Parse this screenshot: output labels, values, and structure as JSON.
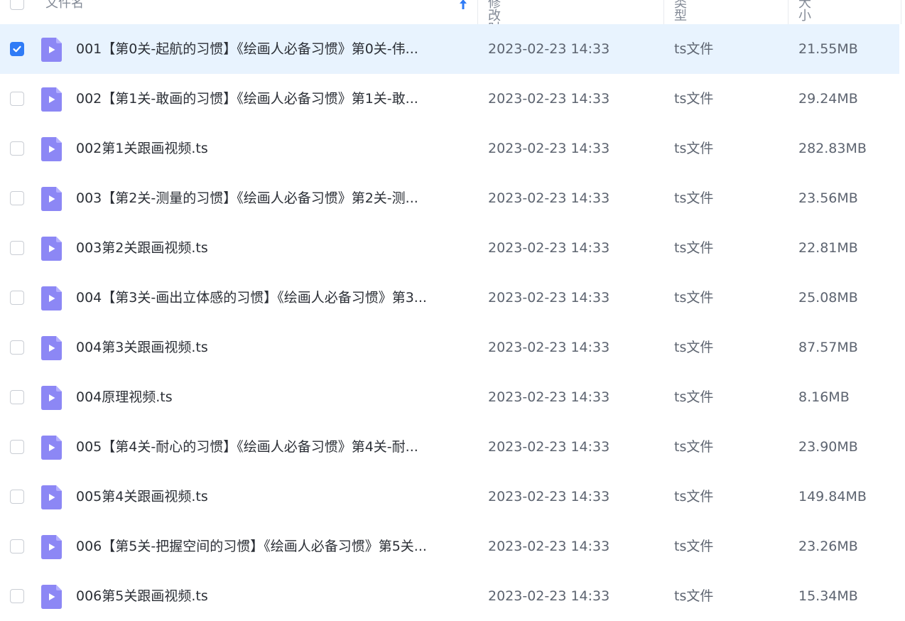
{
  "header": {
    "col_name": "文件名",
    "col_mtime": "修改时间",
    "col_type": "类型",
    "col_size": "大小",
    "sort_icon": "arrow-up-icon",
    "accent": "#2f7bf6"
  },
  "colors": {
    "selected_row_bg": "#e8f3fe",
    "checkbox_checked": "#2f7bf6",
    "file_icon": "#8c87f5"
  },
  "files": [
    {
      "name": "001【第0关-起航的习惯】《绘画人必备习惯》第0关-伟...",
      "mtime": "2023-02-23 14:33",
      "type": "ts文件",
      "size": "21.55MB",
      "checked": true
    },
    {
      "name": "002【第1关-敢画的习惯】《绘画人必备习惯》第1关-敢...",
      "mtime": "2023-02-23 14:33",
      "type": "ts文件",
      "size": "29.24MB",
      "checked": false
    },
    {
      "name": "002第1关跟画视频.ts",
      "mtime": "2023-02-23 14:33",
      "type": "ts文件",
      "size": "282.83MB",
      "checked": false
    },
    {
      "name": "003【第2关-测量的习惯】《绘画人必备习惯》第2关-测...",
      "mtime": "2023-02-23 14:33",
      "type": "ts文件",
      "size": "23.56MB",
      "checked": false
    },
    {
      "name": "003第2关跟画视频.ts",
      "mtime": "2023-02-23 14:33",
      "type": "ts文件",
      "size": "22.81MB",
      "checked": false
    },
    {
      "name": "004【第3关-画出立体感的习惯】《绘画人必备习惯》第3...",
      "mtime": "2023-02-23 14:33",
      "type": "ts文件",
      "size": "25.08MB",
      "checked": false
    },
    {
      "name": "004第3关跟画视频.ts",
      "mtime": "2023-02-23 14:33",
      "type": "ts文件",
      "size": "87.57MB",
      "checked": false
    },
    {
      "name": "004原理视频.ts",
      "mtime": "2023-02-23 14:33",
      "type": "ts文件",
      "size": "8.16MB",
      "checked": false
    },
    {
      "name": "005【第4关-耐心的习惯】《绘画人必备习惯》第4关-耐...",
      "mtime": "2023-02-23 14:33",
      "type": "ts文件",
      "size": "23.90MB",
      "checked": false
    },
    {
      "name": "005第4关跟画视频.ts",
      "mtime": "2023-02-23 14:33",
      "type": "ts文件",
      "size": "149.84MB",
      "checked": false
    },
    {
      "name": "006【第5关-把握空间的习惯】《绘画人必备习惯》第5关...",
      "mtime": "2023-02-23 14:33",
      "type": "ts文件",
      "size": "23.26MB",
      "checked": false
    },
    {
      "name": "006第5关跟画视频.ts",
      "mtime": "2023-02-23 14:33",
      "type": "ts文件",
      "size": "15.34MB",
      "checked": false
    }
  ]
}
